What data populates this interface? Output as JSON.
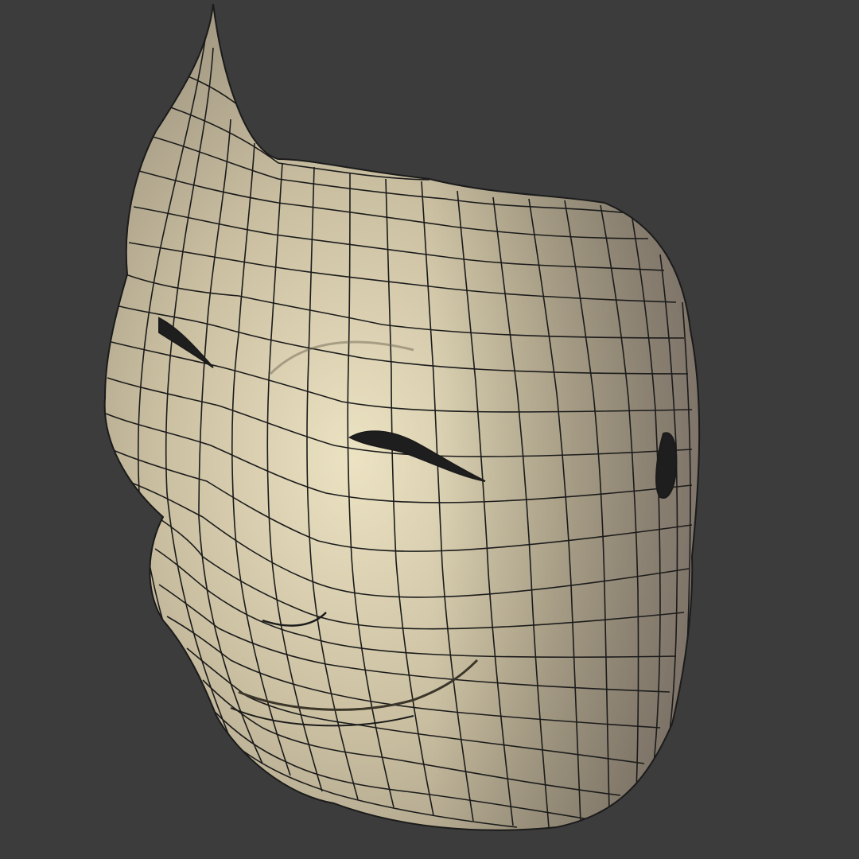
{
  "scene": {
    "subject": "3d-wireframe-mask",
    "background_color": "#3c3c3c",
    "surface_color": "#c9bea0",
    "surface_highlight": "#ece3c3",
    "surface_shadow": "#8a8170",
    "wire_color": "#1b1b1b",
    "hole_color": "#1e1e1e"
  }
}
